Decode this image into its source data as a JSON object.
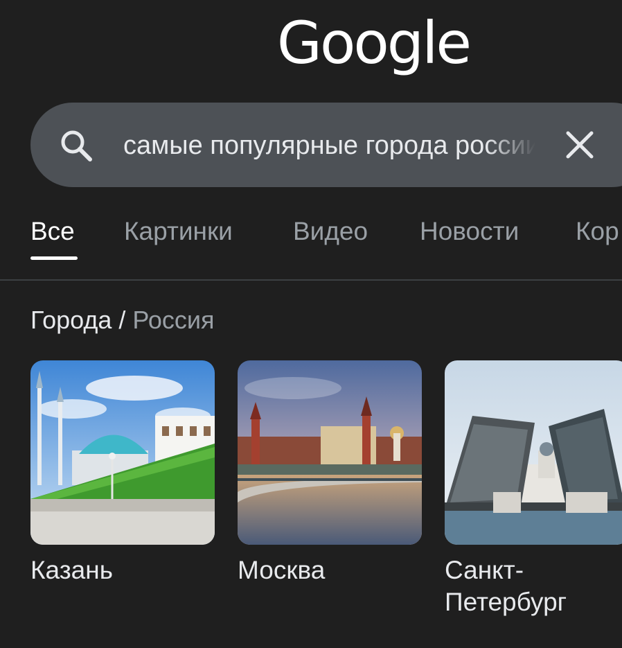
{
  "logo": {
    "text": "Google"
  },
  "search": {
    "query": "самые популярные города россии"
  },
  "tabs": [
    {
      "label": "Все",
      "active": true
    },
    {
      "label": "Картинки",
      "active": false
    },
    {
      "label": "Видео",
      "active": false
    },
    {
      "label": "Новости",
      "active": false
    },
    {
      "label": "Кор",
      "active": false
    }
  ],
  "breadcrumb": {
    "main": "Города",
    "separator": " / ",
    "sub": "Россия"
  },
  "cards": [
    {
      "label": "Казань",
      "image": "kazan-kremlin-photo"
    },
    {
      "label": "Москва",
      "image": "moscow-kremlin-photo"
    },
    {
      "label": "Санкт-\nПетербург",
      "image": "saint-petersburg-bridge-photo"
    }
  ],
  "colors": {
    "background": "#1f1f1f",
    "search_bar": "#4d5156",
    "active_text": "#ffffff",
    "inactive_text": "#9aa0a6",
    "divider": "#3c4043"
  }
}
